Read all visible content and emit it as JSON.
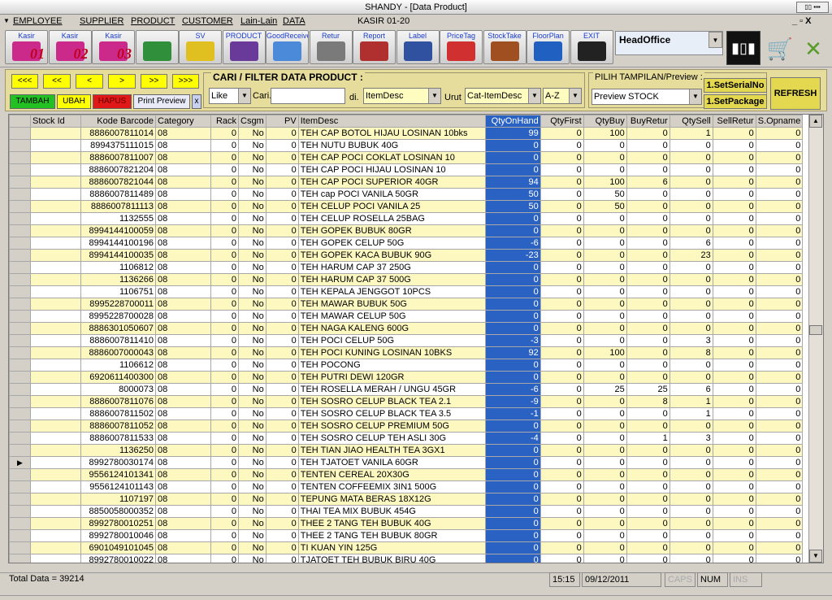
{
  "window": {
    "title": "SHANDY - [Data Product]"
  },
  "menu": {
    "items": [
      "EMPLOYEE",
      "SUPPLIER",
      "PRODUCT",
      "CUSTOMER",
      "Lain-Lain",
      "DATA"
    ],
    "kasir": "KASIR 01-20",
    "min_restore_close": "_ ▫ X"
  },
  "toolbar": {
    "buttons": [
      {
        "label": "Kasir",
        "num": "01"
      },
      {
        "label": "Kasir",
        "num": "02"
      },
      {
        "label": "Kasir",
        "num": "03"
      },
      {
        "label": "",
        "num": ""
      },
      {
        "label": "SV",
        "num": ""
      },
      {
        "label": "PRODUCT",
        "num": ""
      },
      {
        "label": "GoodReceived",
        "num": ""
      },
      {
        "label": "Retur",
        "num": ""
      },
      {
        "label": "Report",
        "num": ""
      },
      {
        "label": "Label",
        "num": ""
      },
      {
        "label": "PriceTag",
        "num": ""
      },
      {
        "label": "StockTake",
        "num": ""
      },
      {
        "label": "FloorPlan",
        "num": ""
      },
      {
        "label": "EXIT",
        "num": ""
      }
    ],
    "location": "HeadOffice"
  },
  "nav": {
    "first": "<<<",
    "prev_page": "<<",
    "prev": "<",
    "next": ">",
    "next_page": ">>",
    "last": ">>>"
  },
  "actions": {
    "add": "TAMBAH",
    "edit": "UBAH",
    "delete": "HAPUS",
    "print": "Print Preview",
    "close": "x"
  },
  "filter": {
    "title": "CARI / FILTER DATA PRODUCT :",
    "mode": "Like",
    "cari_label": "Cari.",
    "di_label": "di.",
    "field": "ItemDesc",
    "urut_label": "Urut",
    "sort_field": "Cat-ItemDesc",
    "sort_dir": "A-Z"
  },
  "view": {
    "title": "PILIH TAMPILAN/Preview :",
    "selected": "Preview STOCK",
    "set_serial": "1.SetSerialNo",
    "set_package": "1.SetPackage",
    "refresh": "REFRESH"
  },
  "grid": {
    "columns": [
      "",
      "Stock Id",
      "Kode Barcode",
      "Category",
      "Rack",
      "Csgm",
      "PV",
      "ItemDesc",
      "QtyOnHand",
      "QtyFirst",
      "QtyBuy",
      "BuyRetur",
      "QtySell",
      "SellRetur",
      "S.Opname"
    ],
    "current_row_marker": "▶",
    "rows": [
      [
        "",
        "8886007811014",
        "08",
        "0",
        "No",
        "0",
        "TEH CAP BOTOL HIJAU LOSINAN 10bks",
        "99",
        "0",
        "100",
        "0",
        "1",
        "0",
        "0"
      ],
      [
        "",
        "8994375111015",
        "08",
        "0",
        "No",
        "0",
        "TEH NUTU BUBUK 40G",
        "0",
        "0",
        "0",
        "0",
        "0",
        "0",
        "0"
      ],
      [
        "",
        "8886007811007",
        "08",
        "0",
        "No",
        "0",
        "TEH CAP POCI COKLAT LOSINAN 10",
        "0",
        "0",
        "0",
        "0",
        "0",
        "0",
        "0"
      ],
      [
        "",
        "8886007821204",
        "08",
        "0",
        "No",
        "0",
        "TEH CAP POCI HIJAU LOSINAN 10",
        "0",
        "0",
        "0",
        "0",
        "0",
        "0",
        "0"
      ],
      [
        "",
        "8886007821044",
        "08",
        "0",
        "No",
        "0",
        "TEH CAP POCI SUPERIOR 40GR",
        "94",
        "0",
        "100",
        "6",
        "0",
        "0",
        "0"
      ],
      [
        "",
        "8886007811489",
        "08",
        "0",
        "No",
        "0",
        "TEH cap POCI VANILA 50GR",
        "50",
        "0",
        "50",
        "0",
        "0",
        "0",
        "0"
      ],
      [
        "",
        "8886007811113",
        "08",
        "0",
        "No",
        "0",
        "TEH CELUP POCI VANILA 25",
        "50",
        "0",
        "50",
        "0",
        "0",
        "0",
        "0"
      ],
      [
        "",
        "1132555",
        "08",
        "0",
        "No",
        "0",
        "TEH CELUP ROSELLA 25BAG",
        "0",
        "0",
        "0",
        "0",
        "0",
        "0",
        "0"
      ],
      [
        "",
        "8994144100059",
        "08",
        "0",
        "No",
        "0",
        "TEH GOPEK BUBUK 80GR",
        "0",
        "0",
        "0",
        "0",
        "0",
        "0",
        "0"
      ],
      [
        "",
        "8994144100196",
        "08",
        "0",
        "No",
        "0",
        "TEH GOPEK CELUP 50G",
        "-6",
        "0",
        "0",
        "0",
        "6",
        "0",
        "0"
      ],
      [
        "",
        "8994144100035",
        "08",
        "0",
        "No",
        "0",
        "TEH GOPEK KACA BUBUK 90G",
        "-23",
        "0",
        "0",
        "0",
        "23",
        "0",
        "0"
      ],
      [
        "",
        "1106812",
        "08",
        "0",
        "No",
        "0",
        "TEH HARUM CAP 37 250G",
        "0",
        "0",
        "0",
        "0",
        "0",
        "0",
        "0"
      ],
      [
        "",
        "1136266",
        "08",
        "0",
        "No",
        "0",
        "TEH HARUM CAP 37 500G",
        "0",
        "0",
        "0",
        "0",
        "0",
        "0",
        "0"
      ],
      [
        "",
        "1106751",
        "08",
        "0",
        "No",
        "0",
        "TEH KEPALA JENGGOT 10PCS",
        "0",
        "0",
        "0",
        "0",
        "0",
        "0",
        "0"
      ],
      [
        "",
        "8995228700011",
        "08",
        "0",
        "No",
        "0",
        "TEH MAWAR BUBUK 50G",
        "0",
        "0",
        "0",
        "0",
        "0",
        "0",
        "0"
      ],
      [
        "",
        "8995228700028",
        "08",
        "0",
        "No",
        "0",
        "TEH MAWAR CELUP 50G",
        "0",
        "0",
        "0",
        "0",
        "0",
        "0",
        "0"
      ],
      [
        "",
        "8886301050607",
        "08",
        "0",
        "No",
        "0",
        "TEH NAGA KALENG 600G",
        "0",
        "0",
        "0",
        "0",
        "0",
        "0",
        "0"
      ],
      [
        "",
        "8886007811410",
        "08",
        "0",
        "No",
        "0",
        "TEH POCI CELUP 50G",
        "-3",
        "0",
        "0",
        "0",
        "3",
        "0",
        "0"
      ],
      [
        "",
        "8886007000043",
        "08",
        "0",
        "No",
        "0",
        "TEH POCI KUNING LOSINAN 10BKS",
        "92",
        "0",
        "100",
        "0",
        "8",
        "0",
        "0"
      ],
      [
        "",
        "1106612",
        "08",
        "0",
        "No",
        "0",
        "TEH POCONG",
        "0",
        "0",
        "0",
        "0",
        "0",
        "0",
        "0"
      ],
      [
        "",
        "6920611400300",
        "08",
        "0",
        "No",
        "0",
        "TEH PUTRI DEWI 120GR",
        "0",
        "0",
        "0",
        "0",
        "0",
        "0",
        "0"
      ],
      [
        "",
        "8000073",
        "08",
        "0",
        "No",
        "0",
        "TEH ROSELLA  MERAH / UNGU 45GR",
        "-6",
        "0",
        "25",
        "25",
        "6",
        "0",
        "0"
      ],
      [
        "",
        "8886007811076",
        "08",
        "0",
        "No",
        "0",
        "TEH SOSRO CELUP BLACK TEA 2.1",
        "-9",
        "0",
        "0",
        "8",
        "1",
        "0",
        "0"
      ],
      [
        "",
        "8886007811502",
        "08",
        "0",
        "No",
        "0",
        "TEH SOSRO CELUP BLACK TEA 3.5",
        "-1",
        "0",
        "0",
        "0",
        "1",
        "0",
        "0"
      ],
      [
        "",
        "8886007811052",
        "08",
        "0",
        "No",
        "0",
        "TEH SOSRO CELUP PREMIUM 50G",
        "0",
        "0",
        "0",
        "0",
        "0",
        "0",
        "0"
      ],
      [
        "",
        "8886007811533",
        "08",
        "0",
        "No",
        "0",
        "TEH SOSRO CELUP TEH ASLI 30G",
        "-4",
        "0",
        "0",
        "1",
        "3",
        "0",
        "0"
      ],
      [
        "",
        "1136250",
        "08",
        "0",
        "No",
        "0",
        "TEH TIAN JIAO HEALTH TEA 3GX1",
        "0",
        "0",
        "0",
        "0",
        "0",
        "0",
        "0"
      ],
      [
        "",
        "8992780030174",
        "08",
        "0",
        "No",
        "0",
        "TEH TJATOET VANILA 60GR",
        "0",
        "0",
        "0",
        "0",
        "0",
        "0",
        "0"
      ],
      [
        "",
        "9556124101341",
        "08",
        "0",
        "No",
        "0",
        "TENTEN CEREAL 20X30G",
        "0",
        "0",
        "0",
        "0",
        "0",
        "0",
        "0"
      ],
      [
        "",
        "9556124101143",
        "08",
        "0",
        "No",
        "0",
        "TENTEN COFFEEMIX 3IN1 500G",
        "0",
        "0",
        "0",
        "0",
        "0",
        "0",
        "0"
      ],
      [
        "",
        "1107197",
        "08",
        "0",
        "No",
        "0",
        "TEPUNG MATA BERAS 18X12G",
        "0",
        "0",
        "0",
        "0",
        "0",
        "0",
        "0"
      ],
      [
        "",
        "8850058000352",
        "08",
        "0",
        "No",
        "0",
        "THAI TEA MIX BUBUK 454G",
        "0",
        "0",
        "0",
        "0",
        "0",
        "0",
        "0"
      ],
      [
        "",
        "8992780010251",
        "08",
        "0",
        "No",
        "0",
        "THEE 2 TANG TEH BUBUK 40G",
        "0",
        "0",
        "0",
        "0",
        "0",
        "0",
        "0"
      ],
      [
        "",
        "8992780010046",
        "08",
        "0",
        "No",
        "0",
        "THEE 2 TANG TEH BUBUK 80GR",
        "0",
        "0",
        "0",
        "0",
        "0",
        "0",
        "0"
      ],
      [
        "",
        "6901049101045",
        "08",
        "0",
        "No",
        "0",
        "TI KUAN YIN 125G",
        "0",
        "0",
        "0",
        "0",
        "0",
        "0",
        "0"
      ],
      [
        "",
        "8992780010022",
        "08",
        "0",
        "No",
        "0",
        "TJATOET TEH BUBUK BIRU 40G",
        "0",
        "0",
        "0",
        "0",
        "0",
        "0",
        "0"
      ]
    ],
    "current_row": 27
  },
  "status": {
    "total": "Total Data = 39214",
    "time": "15:15",
    "date": "09/12/2011",
    "caps": "CAPS",
    "num": "NUM",
    "ins": "INS"
  },
  "colors": {
    "grid_highlight": "#2a62c4",
    "row_alt": "#fdf8c0",
    "panel": "#e6dc9c"
  }
}
